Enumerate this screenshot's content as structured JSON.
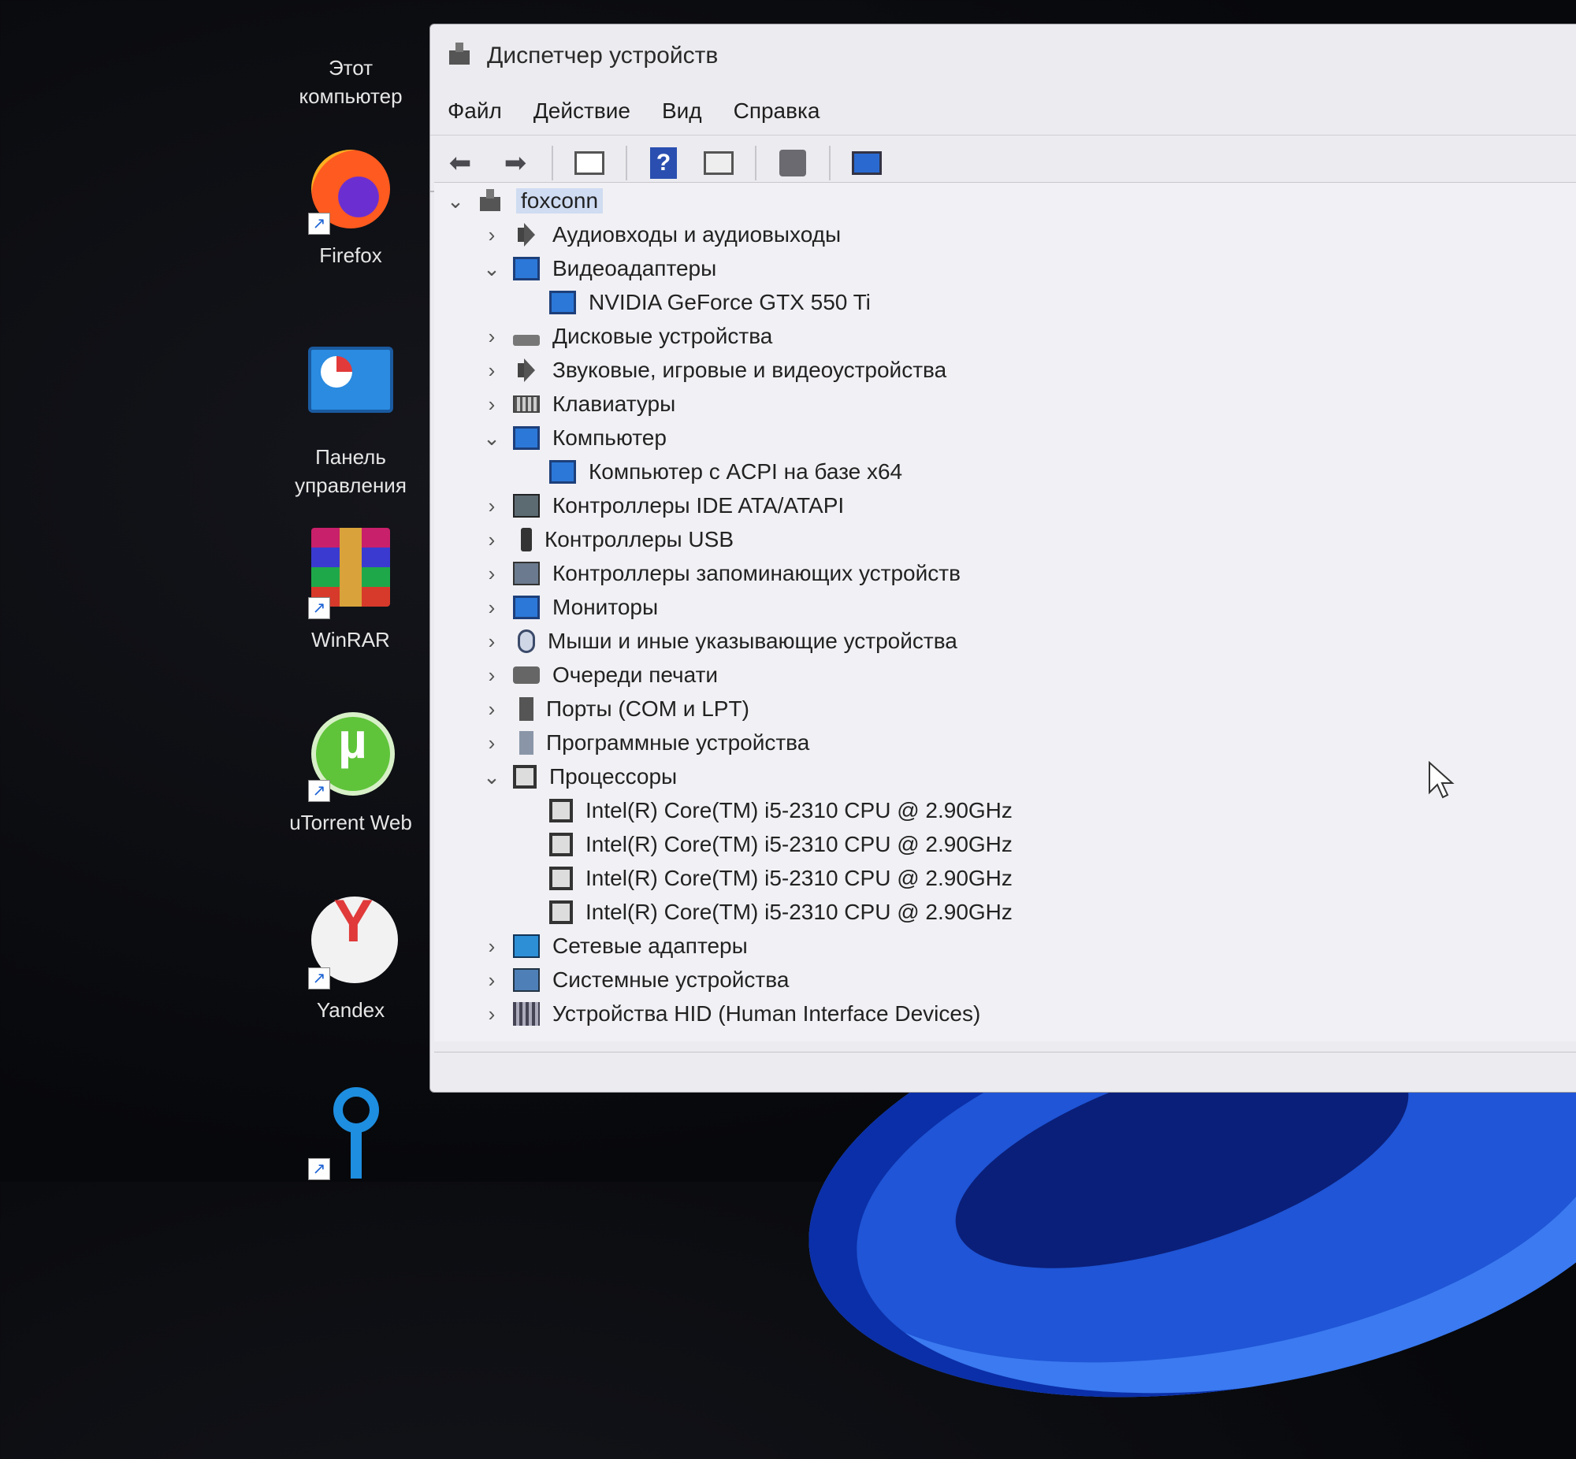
{
  "desktop": {
    "icons": [
      {
        "label_l1": "Этот",
        "label_l2": "компьютер"
      },
      {
        "label_l1": "Firefox"
      },
      {
        "label_l1": "Панель",
        "label_l2": "управления"
      },
      {
        "label_l1": "WinRAR"
      },
      {
        "label_l1": "uTorrent Web"
      },
      {
        "label_l1": "Yandex"
      }
    ]
  },
  "window": {
    "title": "Диспетчер устройств",
    "menu": [
      "Файл",
      "Действие",
      "Вид",
      "Справка"
    ],
    "toolbar_icons": [
      "back-arrow-icon",
      "forward-arrow-icon",
      "properties-icon",
      "help-icon",
      "view-icon",
      "update-driver-icon",
      "scan-hardware-icon"
    ]
  },
  "tree": {
    "root": "foxconn",
    "nodes": [
      {
        "label": "Аудиовходы и аудиовыходы",
        "expanded": false,
        "icon": "speaker-icon"
      },
      {
        "label": "Видеоадаптеры",
        "expanded": true,
        "icon": "display-adapter-icon",
        "children": [
          "NVIDIA GeForce GTX 550 Ti"
        ]
      },
      {
        "label": "Дисковые устройства",
        "expanded": false,
        "icon": "disk-icon"
      },
      {
        "label": "Звуковые, игровые и видеоустройства",
        "expanded": false,
        "icon": "speaker-icon"
      },
      {
        "label": "Клавиатуры",
        "expanded": false,
        "icon": "keyboard-icon"
      },
      {
        "label": "Компьютер",
        "expanded": true,
        "icon": "computer-icon",
        "children": [
          "Компьютер с ACPI на базе x64"
        ]
      },
      {
        "label": "Контроллеры IDE ATA/ATAPI",
        "expanded": false,
        "icon": "ide-controller-icon"
      },
      {
        "label": "Контроллеры USB",
        "expanded": false,
        "icon": "usb-icon"
      },
      {
        "label": "Контроллеры запоминающих устройств",
        "expanded": false,
        "icon": "storage-controller-icon"
      },
      {
        "label": "Мониторы",
        "expanded": false,
        "icon": "monitor-icon"
      },
      {
        "label": "Мыши и иные указывающие устройства",
        "expanded": false,
        "icon": "mouse-icon"
      },
      {
        "label": "Очереди печати",
        "expanded": false,
        "icon": "printer-icon"
      },
      {
        "label": "Порты (COM и LPT)",
        "expanded": false,
        "icon": "port-icon"
      },
      {
        "label": "Программные устройства",
        "expanded": false,
        "icon": "software-device-icon"
      },
      {
        "label": "Процессоры",
        "expanded": true,
        "icon": "processor-icon",
        "children": [
          "Intel(R) Core(TM) i5-2310 CPU @ 2.90GHz",
          "Intel(R) Core(TM) i5-2310 CPU @ 2.90GHz",
          "Intel(R) Core(TM) i5-2310 CPU @ 2.90GHz",
          "Intel(R) Core(TM) i5-2310 CPU @ 2.90GHz"
        ]
      },
      {
        "label": "Сетевые адаптеры",
        "expanded": false,
        "icon": "network-adapter-icon"
      },
      {
        "label": "Системные устройства",
        "expanded": false,
        "icon": "system-device-icon"
      },
      {
        "label": "Устройства HID (Human Interface Devices)",
        "expanded": false,
        "icon": "hid-icon"
      }
    ]
  }
}
